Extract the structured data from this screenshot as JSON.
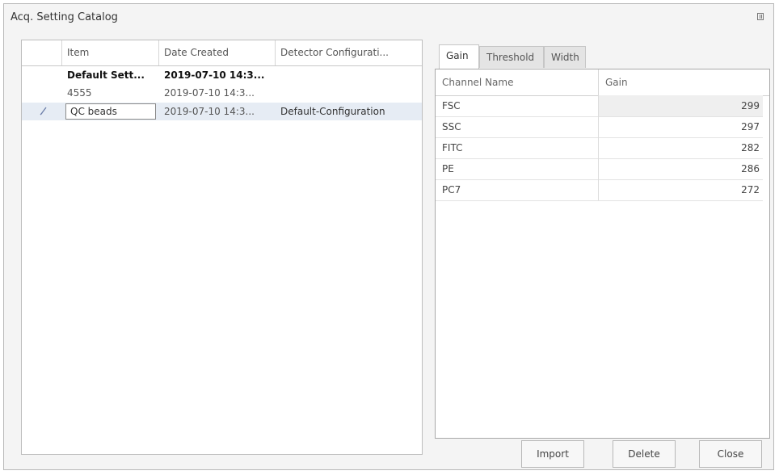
{
  "window": {
    "title": "Acq. Setting Catalog",
    "pin_icon": "pin-icon"
  },
  "left_table": {
    "columns": [
      "",
      "Item",
      "Date Created",
      "Detector Configurati..."
    ],
    "rows": [
      {
        "icon": "",
        "item": "Default Sett...",
        "date": "2019-07-10 14:3...",
        "config": "",
        "bold": true,
        "selected": false
      },
      {
        "icon": "",
        "item": "4555",
        "date": "2019-07-10 14:3...",
        "config": "",
        "bold": false,
        "selected": false
      },
      {
        "icon": "edit-icon",
        "item": "QC beads",
        "date": "2019-07-10 14:3...",
        "config": "Default-Configuration",
        "bold": false,
        "selected": true
      }
    ]
  },
  "tabs": [
    {
      "label": "Gain",
      "active": true
    },
    {
      "label": "Threshold",
      "active": false
    },
    {
      "label": "Width",
      "active": false
    }
  ],
  "gain_table": {
    "columns": [
      "Channel Name",
      "Gain"
    ],
    "rows": [
      {
        "name": "FSC",
        "value": "299"
      },
      {
        "name": "SSC",
        "value": "297"
      },
      {
        "name": "FITC",
        "value": "282"
      },
      {
        "name": "PE",
        "value": "286"
      },
      {
        "name": "PC7",
        "value": "272"
      }
    ]
  },
  "buttons": {
    "import": "Import",
    "delete": "Delete",
    "close": "Close"
  }
}
